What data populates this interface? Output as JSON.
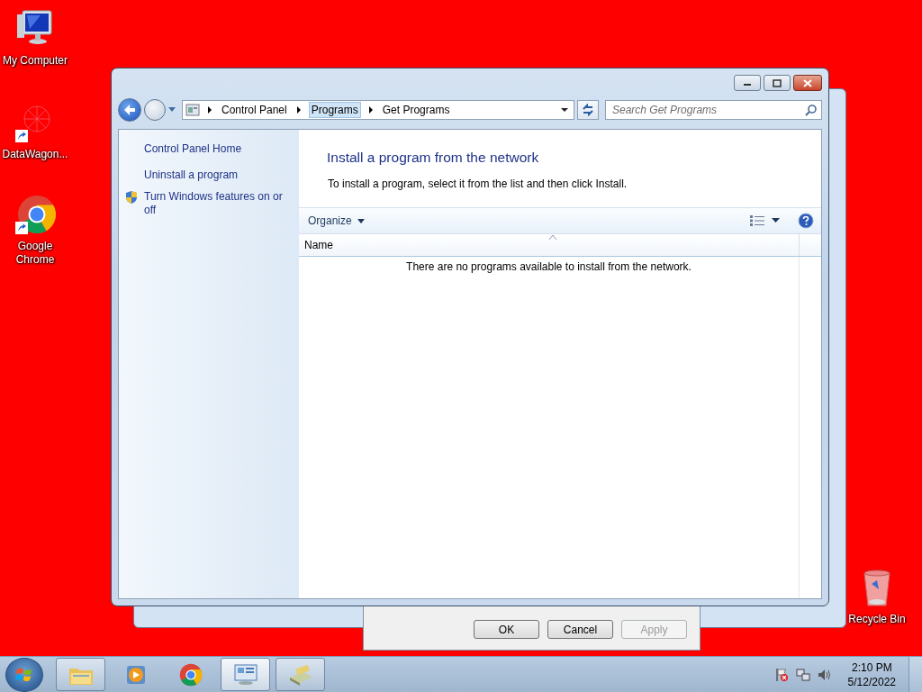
{
  "desktop_icons": [
    {
      "label": "My Computer",
      "kind": "computer",
      "shortcut": false
    },
    {
      "label": "DataWagon...",
      "kind": "app",
      "shortcut": true
    },
    {
      "label": "Google Chrome",
      "kind": "chrome",
      "shortcut": true
    },
    {
      "label": "Recycle Bin",
      "kind": "recycle",
      "shortcut": false
    }
  ],
  "window": {
    "breadcrumb": [
      {
        "label": "Control Panel",
        "highlighted": false
      },
      {
        "label": "Programs",
        "highlighted": true
      },
      {
        "label": "Get Programs",
        "highlighted": false
      }
    ],
    "search": {
      "placeholder": "Search Get Programs"
    },
    "sidebar": {
      "items": [
        {
          "label": "Control Panel Home",
          "kind": "link"
        },
        {
          "label": "Uninstall a program",
          "kind": "link"
        },
        {
          "label": "Turn Windows features on or off",
          "kind": "shield"
        }
      ]
    },
    "heading": "Install a program from the network",
    "instruction": "To install a program, select it from the list and then click Install.",
    "toolbar": {
      "organize": "Organize"
    },
    "table": {
      "columns": [
        "Name"
      ],
      "empty_message": "There are no programs available to install from the network."
    }
  },
  "dialog": {
    "buttons": [
      {
        "label": "OK",
        "disabled": false
      },
      {
        "label": "Cancel",
        "disabled": false
      },
      {
        "label": "Apply",
        "disabled": true
      }
    ]
  },
  "taskbar": {
    "items": [
      {
        "kind": "explorer",
        "open": true,
        "active": false
      },
      {
        "kind": "media",
        "open": false,
        "active": false
      },
      {
        "kind": "chrome",
        "open": false,
        "active": false
      },
      {
        "kind": "control-panel",
        "open": true,
        "active": true
      },
      {
        "kind": "programs",
        "open": true,
        "active": false
      }
    ],
    "time": "2:10 PM",
    "date": "5/12/2022"
  }
}
